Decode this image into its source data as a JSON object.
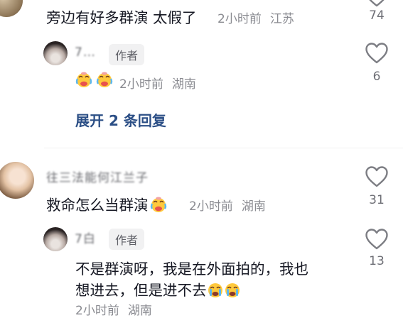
{
  "comments": [
    {
      "text": "旁边有好多群演 太假了",
      "time": "2小时前",
      "location": "江苏",
      "likes": "74",
      "reply": {
        "username": "7…",
        "badge": "作者",
        "emoji": [
          "cry-laugh-emoji",
          "cry-laugh-emoji"
        ],
        "time": "2小时前",
        "location": "湖南",
        "likes": "6"
      },
      "expand_label": "展开 2 条回复"
    },
    {
      "username": "往三法能何江兰子",
      "text": "救命怎么当群演",
      "emoji": [
        "cry-laugh-emoji"
      ],
      "time": "2小时前",
      "location": "湖南",
      "likes": "31",
      "reply": {
        "username": "7白",
        "badge": "作者",
        "text_line1": "不是群演呀，我是在外面拍的，我也",
        "text_line2": "想进去，但是进不去",
        "emoji": [
          "cry-sad-emoji",
          "cry-sad-emoji"
        ],
        "time": "2小时前",
        "location": "湖南",
        "likes": "13"
      }
    }
  ],
  "colors": {
    "text": "#161823",
    "meta": "#8a8b91",
    "link": "#2c4f86",
    "badge_bg": "#f1f1f2"
  }
}
